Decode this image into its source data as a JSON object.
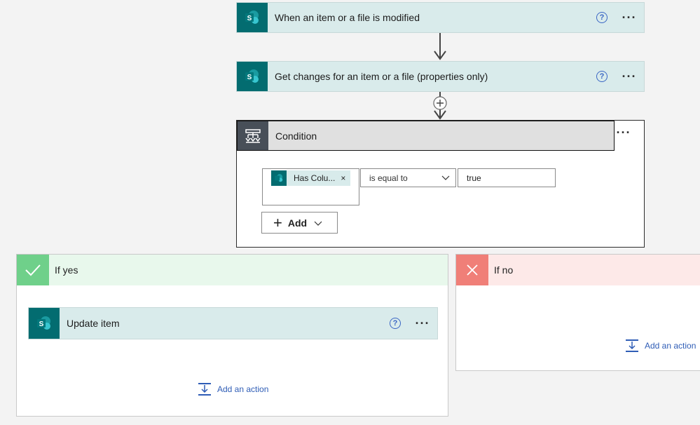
{
  "flow": {
    "trigger": {
      "title": "When an item or a file is modified",
      "help": "?",
      "more": "···"
    },
    "action1": {
      "title": "Get changes for an item or a file (properties only)",
      "help": "?",
      "more": "···"
    },
    "condition": {
      "title": "Condition",
      "more": "···",
      "token_label": "Has Colu...",
      "token_remove": "×",
      "operator": "is equal to",
      "value": "true",
      "add_label": "Add"
    },
    "if_yes": {
      "title": "If yes",
      "action": {
        "title": "Update item",
        "help": "?",
        "more": "···"
      },
      "add_action": "Add an action"
    },
    "if_no": {
      "title": "If no",
      "add_action": "Add an action"
    }
  },
  "colors": {
    "sharepoint_teal": "#036c70",
    "card_bg": "#d9ebeb",
    "yes_green": "#6fd08a",
    "no_red": "#f07f78",
    "link_blue": "#2f5db6"
  }
}
